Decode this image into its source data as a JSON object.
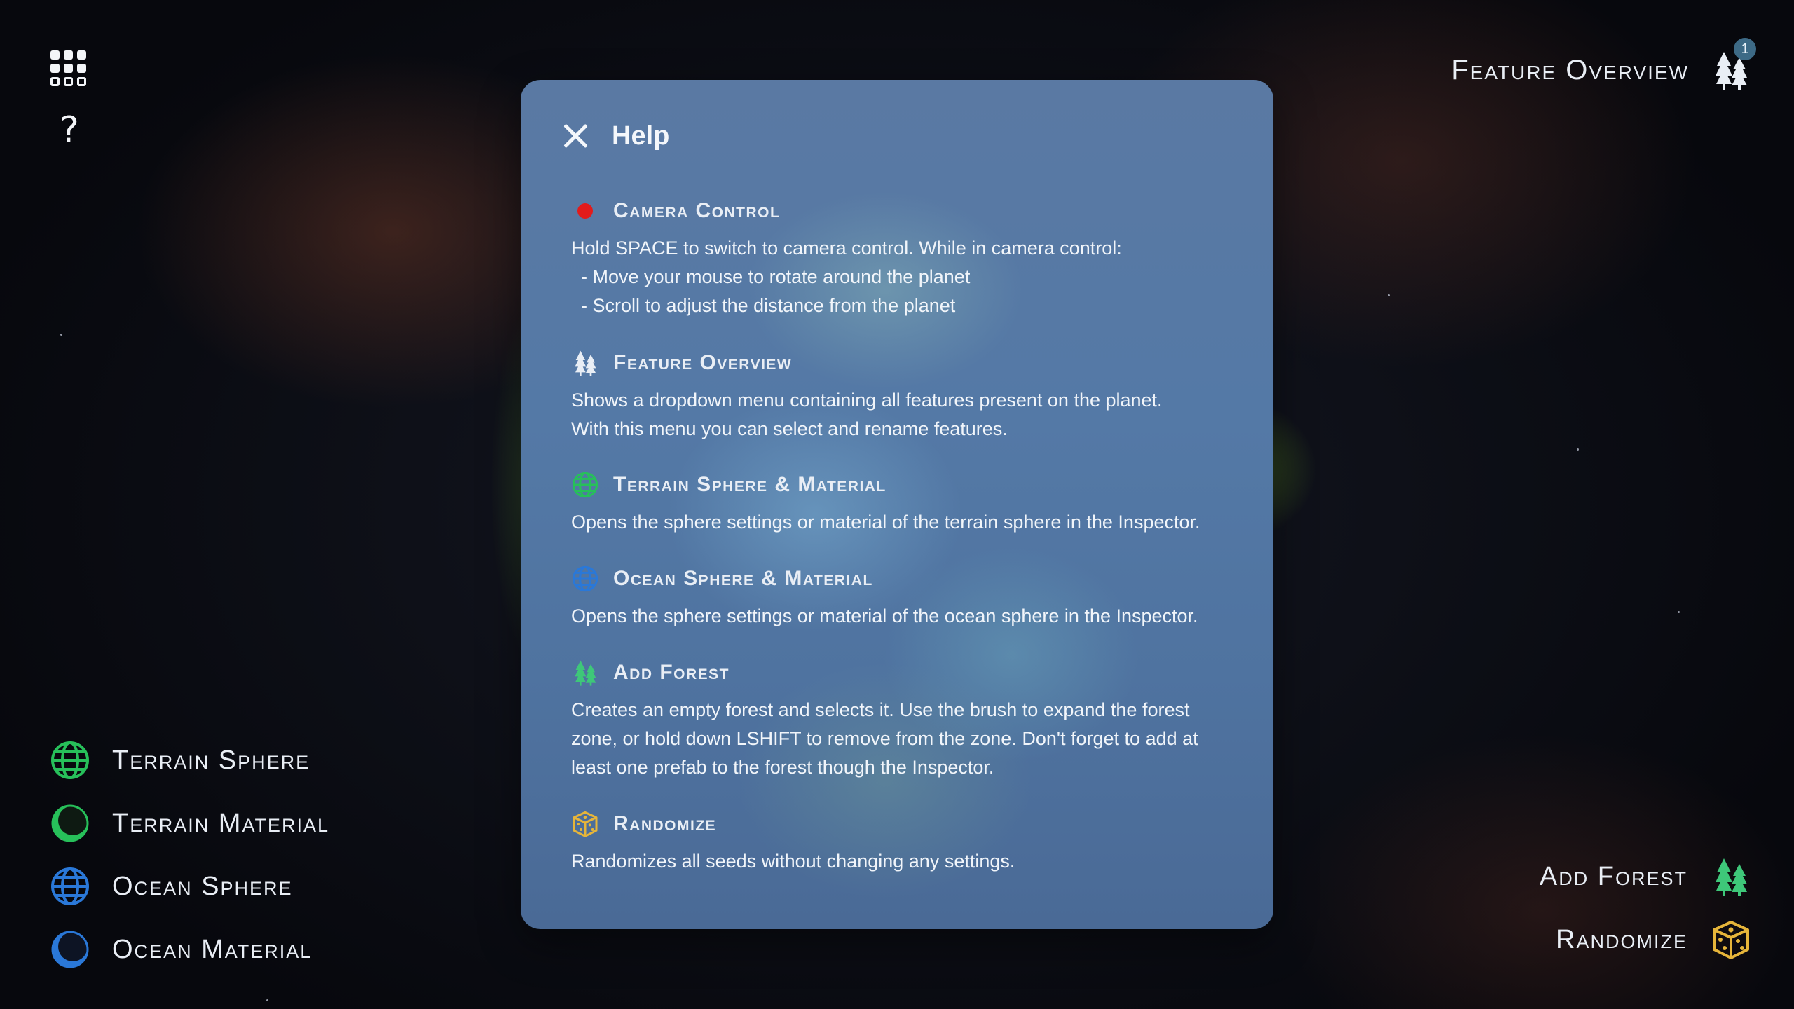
{
  "top_left": {
    "menu_icon": "grid-icon",
    "help_symbol": "?"
  },
  "feature_overview": {
    "label": "Feature Overview",
    "badge": "1",
    "icon": "trees-icon"
  },
  "left_menu": [
    {
      "label": "Terrain Sphere",
      "icon": "terrain-sphere-icon",
      "color": "#27c05a"
    },
    {
      "label": "Terrain Material",
      "icon": "terrain-material-icon",
      "color": "#27c05a"
    },
    {
      "label": "Ocean Sphere",
      "icon": "ocean-sphere-icon",
      "color": "#2a78d8"
    },
    {
      "label": "Ocean Material",
      "icon": "ocean-material-icon",
      "color": "#2a78d8"
    }
  ],
  "right_menu": [
    {
      "label": "Add Forest",
      "icon": "forest-icon",
      "color": "#3ec779"
    },
    {
      "label": "Randomize",
      "icon": "dice-icon",
      "color": "#e6b53a"
    }
  ],
  "help": {
    "title": "Help",
    "sections": [
      {
        "title": "Camera Control",
        "icon": "record-dot-icon",
        "lines": [
          "Hold SPACE to switch to camera control. While in camera control:",
          "-  Move your mouse to rotate around the planet",
          "-  Scroll to adjust the distance from the planet"
        ]
      },
      {
        "title": "Feature Overview",
        "icon": "trees-icon",
        "lines": [
          "Shows a dropdown menu containing all features present on the planet.",
          "With this menu you can select and rename features."
        ]
      },
      {
        "title": "Terrain Sphere & Material",
        "icon": "terrain-sphere-icon",
        "lines": [
          "Opens the sphere settings or material of the terrain sphere in the Inspector."
        ]
      },
      {
        "title": "Ocean Sphere & Material",
        "icon": "ocean-sphere-icon",
        "lines": [
          "Opens the sphere settings or material of the ocean sphere in the Inspector."
        ]
      },
      {
        "title": "Add Forest",
        "icon": "forest-icon",
        "lines": [
          "Creates an empty forest and selects it. Use the brush to expand the forest",
          "zone, or hold down LSHIFT to remove from the zone. Don't forget to add at",
          "least one prefab to the forest though the Inspector."
        ]
      },
      {
        "title": "Randomize",
        "icon": "dice-icon",
        "lines": [
          "Randomizes all seeds without changing any settings."
        ]
      }
    ]
  },
  "colors": {
    "camera_dot": "#e21b1b",
    "terrain_green": "#27c05a",
    "ocean_blue": "#2a78d8",
    "forest_green": "#3ec779",
    "dice_gold": "#e6b53a"
  }
}
